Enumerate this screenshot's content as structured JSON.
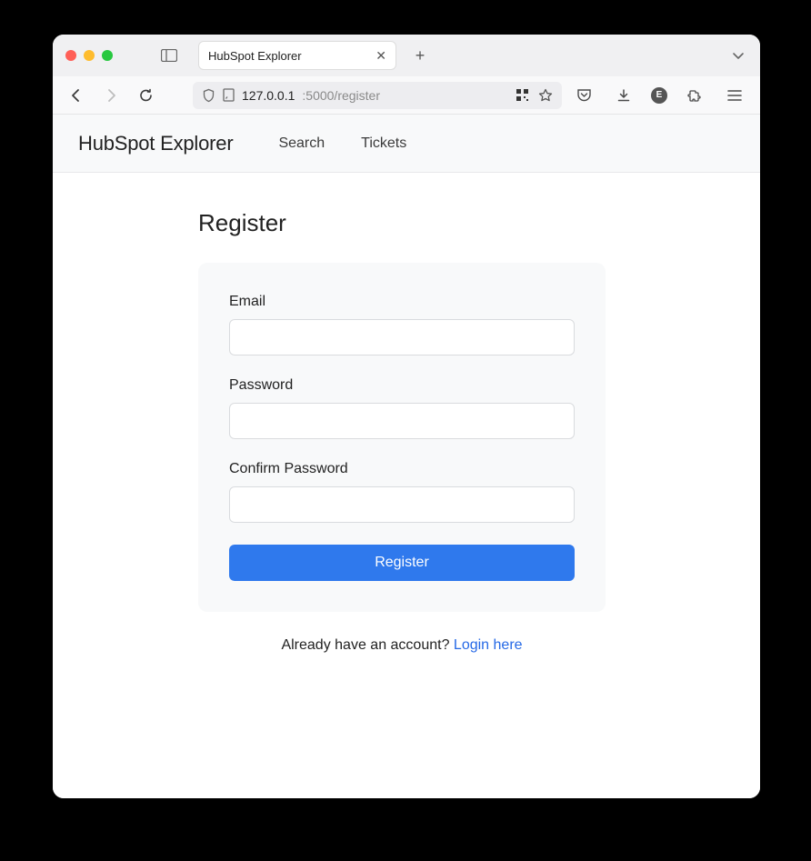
{
  "browser": {
    "tab_title": "HubSpot Explorer",
    "url_host": "127.0.0.1",
    "url_rest": ":5000/register"
  },
  "header": {
    "brand": "HubSpot Explorer",
    "nav": {
      "search": "Search",
      "tickets": "Tickets"
    }
  },
  "page": {
    "title": "Register",
    "form": {
      "email_label": "Email",
      "password_label": "Password",
      "confirm_label": "Confirm Password",
      "submit_label": "Register"
    },
    "footer": {
      "prompt": "Already have an account? ",
      "link_text": "Login here"
    }
  }
}
